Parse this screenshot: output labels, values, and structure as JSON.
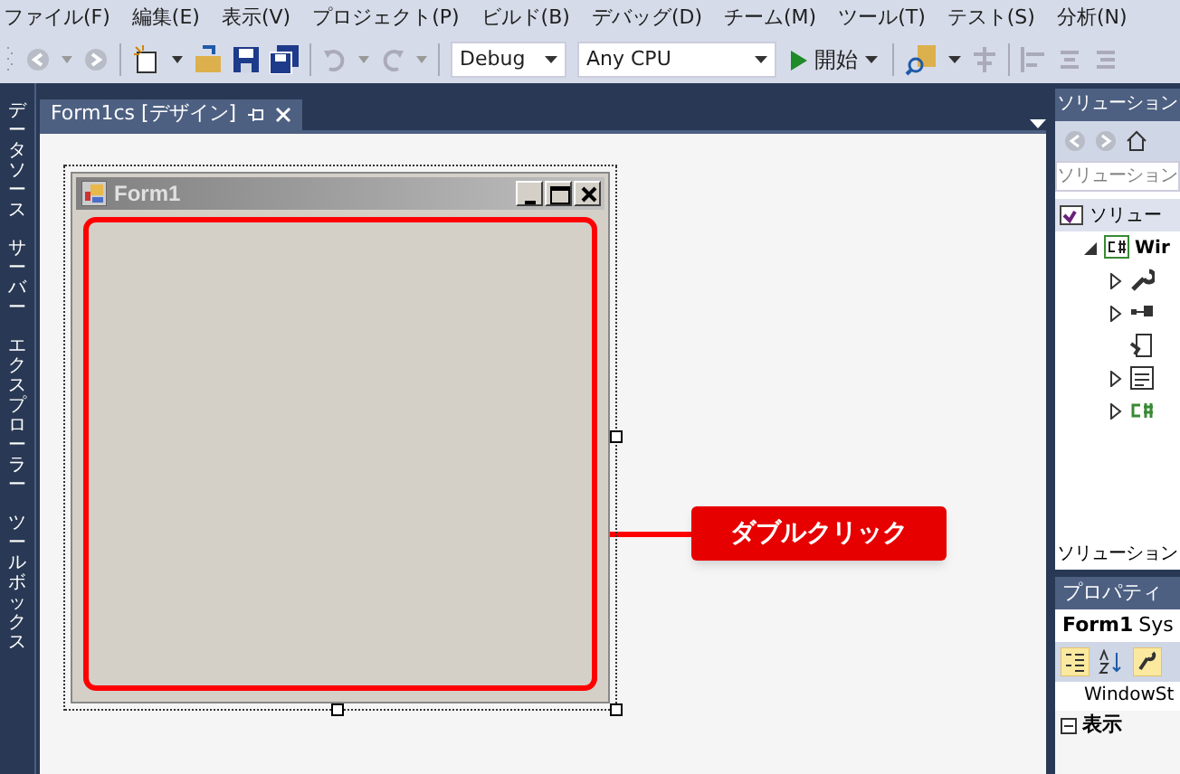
{
  "menu": [
    "ファイル(F)",
    "編集(E)",
    "表示(V)",
    "プロジェクト(P)",
    "ビルド(B)",
    "デバッグ(D)",
    "チーム(M)",
    "ツール(T)",
    "テスト(S)",
    "分析(N)"
  ],
  "toolbar": {
    "configuration": "Debug",
    "platform": "Any CPU",
    "start": "開始"
  },
  "side_tabs": [
    "データソース",
    "サーバー",
    "エクスプローラー",
    "ツールボックス"
  ],
  "document_tab": {
    "label": "Form1cs [デザイン]",
    "selected": true
  },
  "form": {
    "title": "Form1"
  },
  "callout": {
    "label": "ダブルクリック"
  },
  "solution_explorer": {
    "title": "ソリューション",
    "search": {
      "placeholder": "ソリューション"
    },
    "tree": [
      {
        "label": "ソリュー",
        "kind": "solution",
        "children": [
          {
            "label": "Wir",
            "kind": "project",
            "expanded": true,
            "children": [
              {
                "kind": "wrench",
                "expanded": false
              },
              {
                "kind": "refs",
                "expanded": false
              },
              {
                "kind": "config"
              },
              {
                "kind": "form",
                "expanded": false
              },
              {
                "kind": "csharp",
                "expanded": false
              }
            ]
          }
        ]
      }
    ],
    "footer": "ソリューション"
  },
  "properties": {
    "title": "プロパティ",
    "object": "Form1",
    "type": "Sys",
    "property": "WindowSt",
    "category": "表示",
    "category_expanded": true
  }
}
